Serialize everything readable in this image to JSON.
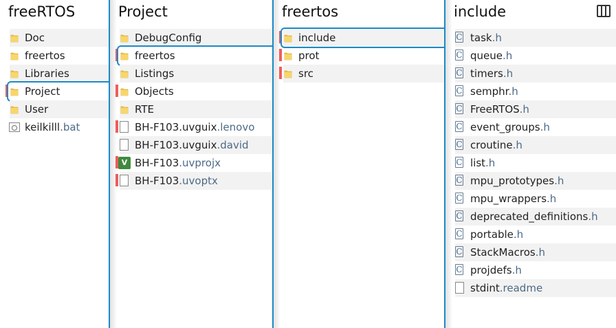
{
  "columns": [
    {
      "title": "freeRTOS",
      "items": [
        {
          "name": "Doc",
          "ext": "",
          "icon": "folder-icon",
          "tag": false,
          "selected": false
        },
        {
          "name": "freertos",
          "ext": "",
          "icon": "folder-icon",
          "tag": false,
          "selected": false
        },
        {
          "name": "Libraries",
          "ext": "",
          "icon": "folder-icon",
          "tag": false,
          "selected": false
        },
        {
          "name": "Project",
          "ext": "",
          "icon": "folder-icon",
          "tag": true,
          "selected": true
        },
        {
          "name": "User",
          "ext": "",
          "icon": "folder-icon",
          "tag": false,
          "selected": false
        },
        {
          "name": "keilkilll",
          "ext": ".bat",
          "icon": "batch-file-icon",
          "tag": false,
          "selected": false
        }
      ]
    },
    {
      "title": "Project",
      "items": [
        {
          "name": "DebugConfig",
          "ext": "",
          "icon": "folder-icon",
          "tag": false,
          "selected": false
        },
        {
          "name": "freertos",
          "ext": "",
          "icon": "folder-icon",
          "tag": true,
          "selected": true
        },
        {
          "name": "Listings",
          "ext": "",
          "icon": "folder-icon",
          "tag": false,
          "selected": false
        },
        {
          "name": "Objects",
          "ext": "",
          "icon": "folder-icon",
          "tag": true,
          "selected": false
        },
        {
          "name": "RTE",
          "ext": "",
          "icon": "folder-icon",
          "tag": false,
          "selected": false
        },
        {
          "name": "BH-F103.uvguix",
          "ext": ".lenovo",
          "icon": "document-icon",
          "tag": true,
          "selected": false
        },
        {
          "name": "BH-F103.uvguix",
          "ext": ".david",
          "icon": "document-icon",
          "tag": false,
          "selected": false
        },
        {
          "name": "BH-F103",
          "ext": ".uvprojx",
          "icon": "keil-project-icon",
          "tag": true,
          "selected": false
        },
        {
          "name": "BH-F103",
          "ext": ".uvoptx",
          "icon": "document-icon",
          "tag": true,
          "selected": false
        }
      ]
    },
    {
      "title": "freertos",
      "items": [
        {
          "name": "include",
          "ext": "",
          "icon": "folder-icon",
          "tag": true,
          "selected": true
        },
        {
          "name": "prot",
          "ext": "",
          "icon": "folder-icon",
          "tag": true,
          "selected": false
        },
        {
          "name": "src",
          "ext": "",
          "icon": "folder-icon",
          "tag": true,
          "selected": false
        }
      ]
    },
    {
      "title": "include",
      "items": [
        {
          "name": "task",
          "ext": ".h",
          "icon": "c-header-file-icon",
          "tag": false,
          "selected": false
        },
        {
          "name": "queue",
          "ext": ".h",
          "icon": "c-header-file-icon",
          "tag": false,
          "selected": false
        },
        {
          "name": "timers",
          "ext": ".h",
          "icon": "c-header-file-icon",
          "tag": false,
          "selected": false
        },
        {
          "name": "semphr",
          "ext": ".h",
          "icon": "c-header-file-icon",
          "tag": false,
          "selected": false
        },
        {
          "name": "FreeRTOS",
          "ext": ".h",
          "icon": "c-header-file-icon",
          "tag": false,
          "selected": false
        },
        {
          "name": "event_groups",
          "ext": ".h",
          "icon": "c-header-file-icon",
          "tag": false,
          "selected": false
        },
        {
          "name": "croutine",
          "ext": ".h",
          "icon": "c-header-file-icon",
          "tag": false,
          "selected": false
        },
        {
          "name": "list",
          "ext": ".h",
          "icon": "c-header-file-icon",
          "tag": false,
          "selected": false
        },
        {
          "name": "mpu_prototypes",
          "ext": ".h",
          "icon": "c-header-file-icon",
          "tag": false,
          "selected": false
        },
        {
          "name": "mpu_wrappers",
          "ext": ".h",
          "icon": "c-header-file-icon",
          "tag": false,
          "selected": false
        },
        {
          "name": "deprecated_definitions",
          "ext": ".h",
          "icon": "c-header-file-icon",
          "tag": false,
          "selected": false
        },
        {
          "name": "portable",
          "ext": ".h",
          "icon": "c-header-file-icon",
          "tag": false,
          "selected": false
        },
        {
          "name": "StackMacros",
          "ext": ".h",
          "icon": "c-header-file-icon",
          "tag": false,
          "selected": false
        },
        {
          "name": "projdefs",
          "ext": ".h",
          "icon": "c-header-file-icon",
          "tag": false,
          "selected": false
        },
        {
          "name": "stdint",
          "ext": ".readme",
          "icon": "document-icon",
          "tag": false,
          "selected": false
        }
      ]
    }
  ],
  "toolbar": {
    "view_toggle_icon": "column-view-icon"
  },
  "colors": {
    "accent": "#1b8ac6",
    "tag_red": "#f25c5c",
    "folder": "#f4c542",
    "row_alt": "#f2f2f2",
    "ext_text": "#4d6a86"
  }
}
